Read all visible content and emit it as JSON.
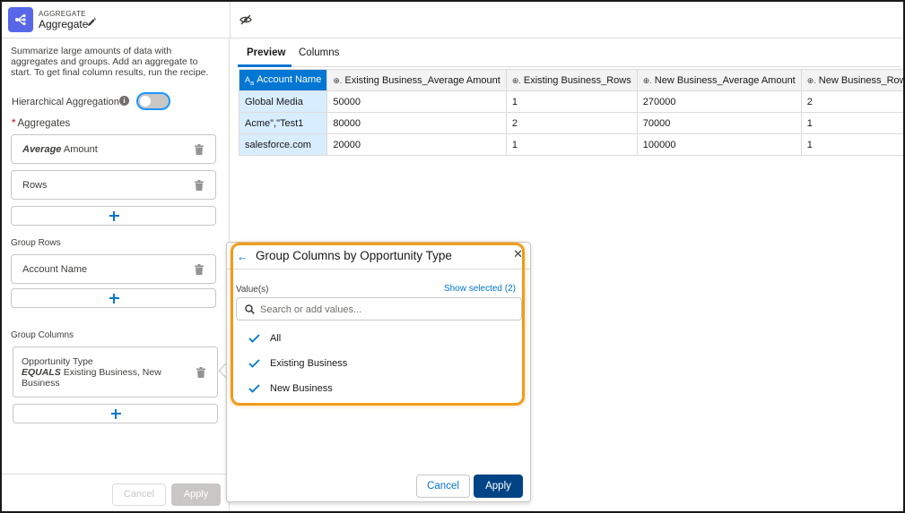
{
  "header": {
    "kicker": "AGGREGATE",
    "title": "Aggregate"
  },
  "left": {
    "description": "Summarize large amounts of data with aggregates and groups. Add an aggregate to start. To get final column results, run the recipe.",
    "hierarchical_label": "Hierarchical Aggregation",
    "hierarchical_enabled": false,
    "aggregates_label": "Aggregates",
    "required_mark": "*",
    "aggregates": [
      {
        "func": "Average",
        "field": "Amount"
      },
      {
        "func": "",
        "field": "Rows"
      }
    ],
    "group_rows_label": "Group Rows",
    "group_rows": [
      "Account Name"
    ],
    "group_columns_label": "Group Columns",
    "group_column": {
      "field": "Opportunity Type",
      "operator": "EQUALS",
      "values": "Existing Business, New Business"
    },
    "cancel_label": "Cancel",
    "apply_label": "Apply"
  },
  "preview": {
    "tabs": [
      "Preview",
      "Columns"
    ],
    "active_tab": "Preview",
    "columns": [
      "Account Name",
      "Existing Business_Average Amount",
      "Existing Business_Rows",
      "New Business_Average Amount",
      "New Business_Rows"
    ],
    "rows": [
      [
        "Global Media",
        "50000",
        "1",
        "270000",
        "2"
      ],
      [
        "Acme\",\"Test1",
        "80000",
        "2",
        "70000",
        "1"
      ],
      [
        "salesforce.com",
        "20000",
        "1",
        "100000",
        "1"
      ]
    ]
  },
  "popover": {
    "title": "Group Columns by Opportunity Type",
    "values_label": "Value(s)",
    "show_selected": "Show selected (2)",
    "search_placeholder": "Search or add values...",
    "options": [
      {
        "label": "All",
        "checked": true
      },
      {
        "label": "Existing Business",
        "checked": true
      },
      {
        "label": "New Business",
        "checked": true
      }
    ],
    "cancel_label": "Cancel",
    "apply_label": "Apply"
  },
  "colors": {
    "brand_blue": "#0176d3",
    "apply_blue": "#014486",
    "highlight_orange": "#f09c1f",
    "app_icon": "#5867e8",
    "key_column_bg": "#d8edff"
  }
}
